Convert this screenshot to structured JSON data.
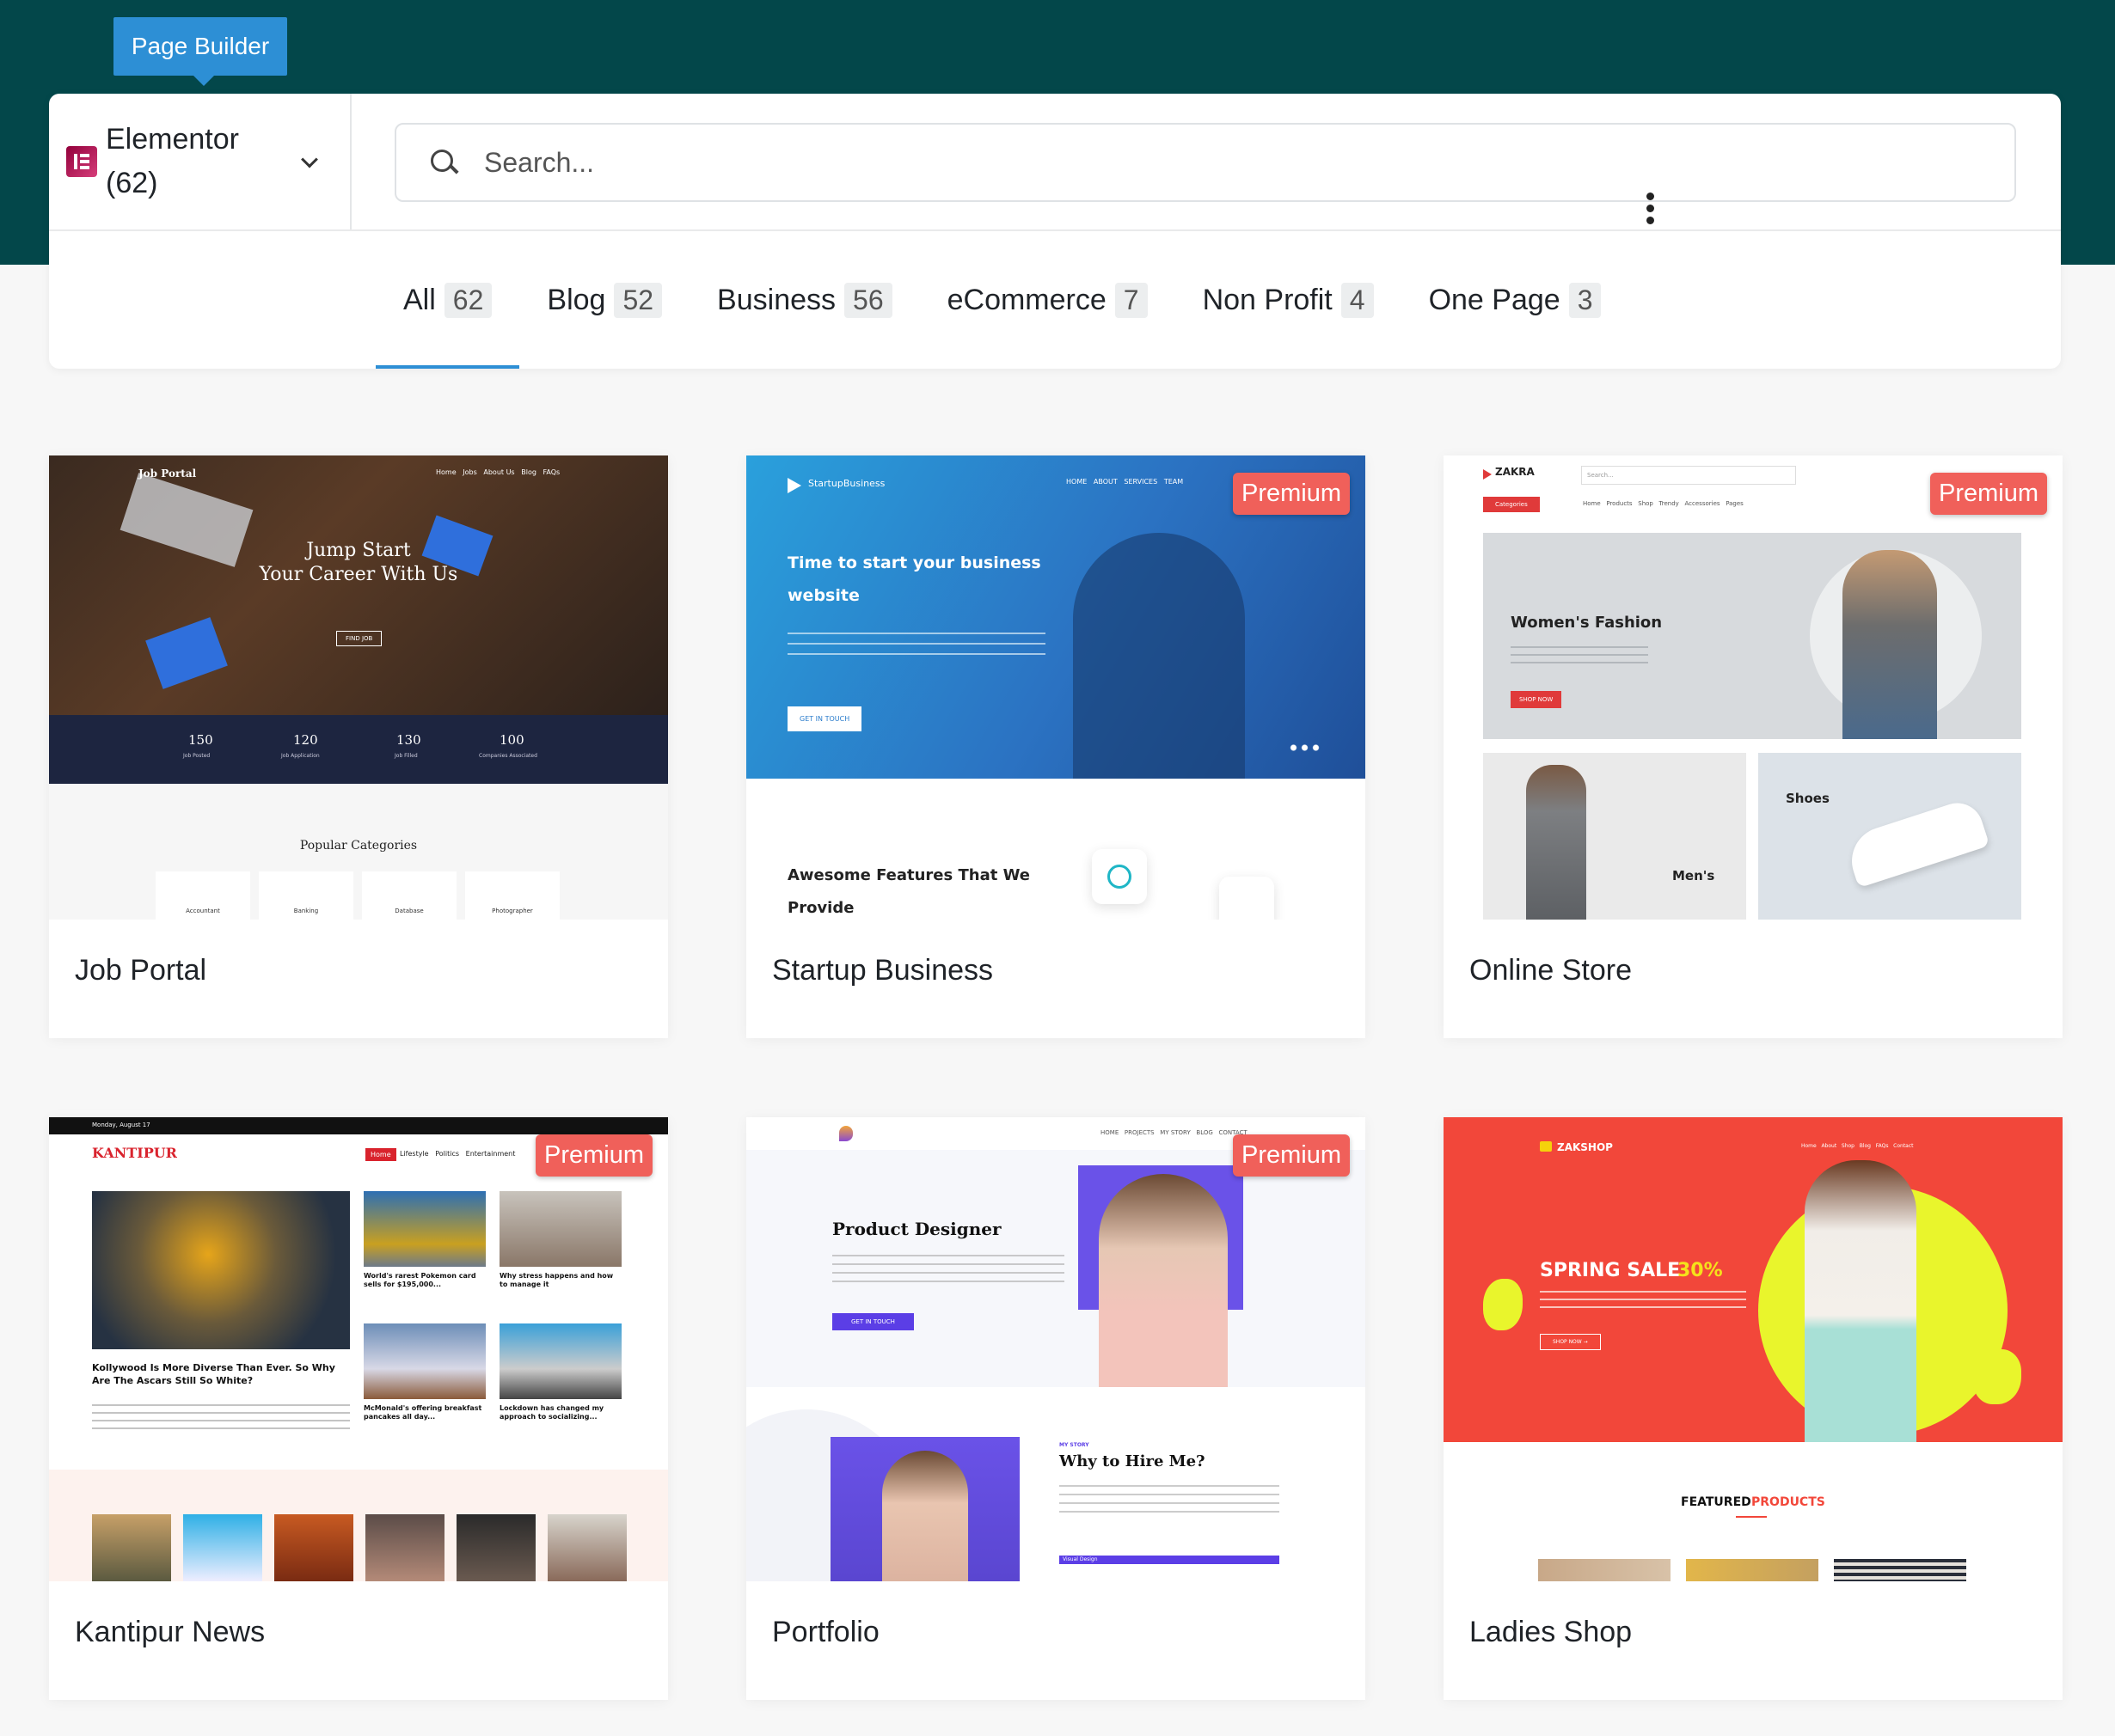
{
  "tooltip": "Page Builder",
  "builder": {
    "name": "Elementor",
    "count": "(62)"
  },
  "search": {
    "placeholder": "Search..."
  },
  "tabs": [
    {
      "label": "All",
      "count": "62"
    },
    {
      "label": "Blog",
      "count": "52"
    },
    {
      "label": "Business",
      "count": "56"
    },
    {
      "label": "eCommerce",
      "count": "7"
    },
    {
      "label": "Non Profit",
      "count": "4"
    },
    {
      "label": "One Page",
      "count": "3"
    }
  ],
  "premium_label": "Premium",
  "templates": [
    {
      "title": "Job Portal",
      "premium": false,
      "preview": {
        "brand": "Job Portal",
        "nav": "Home   Jobs   About Us   Blog   FAQs",
        "hero1": "Jump Start",
        "hero2": "Your Career With Us",
        "btn": "FIND JOB",
        "stats": [
          "150",
          "120",
          "130",
          "100"
        ],
        "stat_labels": [
          "Job Posted",
          "Job Application",
          "Job Filled",
          "Companies Associated"
        ],
        "section": "Popular Categories",
        "cats": [
          "Accountant",
          "Banking",
          "Database",
          "Photographer"
        ]
      }
    },
    {
      "title": "Startup Business",
      "premium": true,
      "preview": {
        "brand": "StartupBusiness",
        "nav": "HOME   ABOUT   SERVICES   TEAM",
        "hero1": "Time to start your business",
        "hero2": "website",
        "btn": "GET IN TOUCH",
        "feature1": "Awesome Features That We",
        "feature2": "Provide"
      }
    },
    {
      "title": "Online Store",
      "premium": true,
      "preview": {
        "brand": "ZAKRA",
        "search": "Search...",
        "cat": "Categories",
        "nav": "Home   Products   Shop   Trendy   Accessories   Pages",
        "hero": "Women's Fashion",
        "btn": "SHOP NOW",
        "tile1": "Men's",
        "tile2": "Shoes"
      }
    },
    {
      "title": "Kantipur News",
      "premium": true,
      "preview": {
        "date": "Monday, August 17",
        "brand": "KANTIPUR",
        "nav": "Lifestyle   Politics   Entertainment",
        "home": "Home",
        "lead": "Kollywood Is More Diverse Than Ever. So Why Are The Ascars Still So White?",
        "s1": "World's rarest Pokemon card sells for $195,000...",
        "s2": "Why stress happens and how to manage it",
        "s3": "McMonald's offering breakfast pancakes all day...",
        "s4": "Lockdown has changed my approach to socializing..."
      }
    },
    {
      "title": "Portfolio",
      "premium": true,
      "preview": {
        "nav": "HOME   PROJECTS   MY STORY   BLOG   CONTACT",
        "hero": "Product Designer",
        "btn": "GET IN TOUCH",
        "story": "MY STORY",
        "hire": "Why to Hire Me?",
        "skill": "Visual Design"
      }
    },
    {
      "title": "Ladies Shop",
      "premium": false,
      "preview": {
        "brand": "ZAKSHOP",
        "nav": "Home   About   Shop   Blog   FAQs   Contact",
        "hero": "SPRING SALE",
        "pct": "30%",
        "btn": "SHOP NOW →",
        "featured": "FEATURED",
        "products": "PRODUCTS"
      }
    }
  ]
}
